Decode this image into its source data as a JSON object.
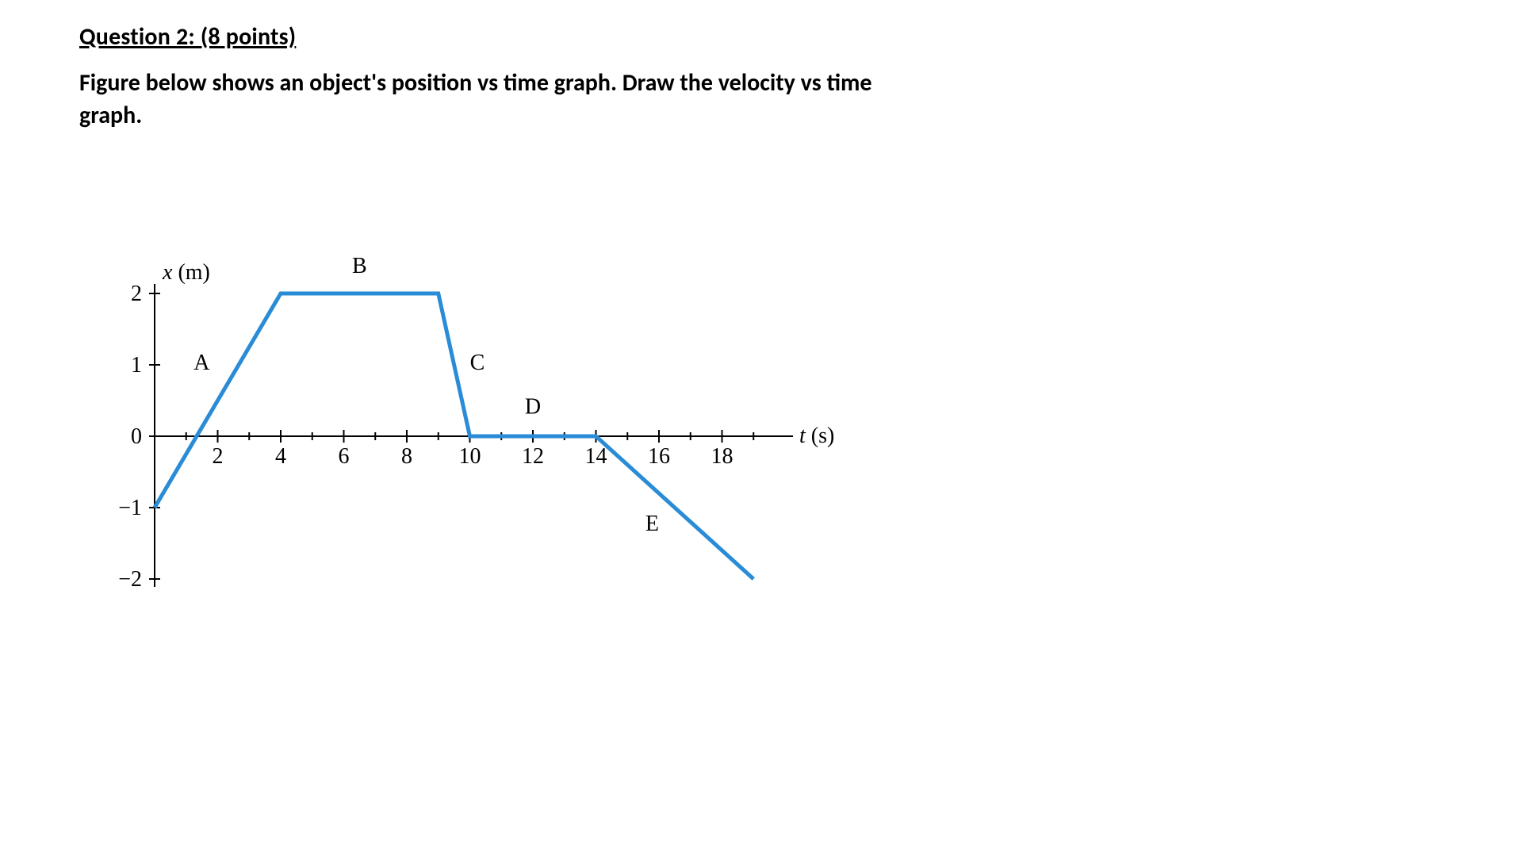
{
  "question": {
    "heading": "Question 2:  (8 points)",
    "body": "Figure below shows an object's position vs time graph.  Draw the velocity vs time graph."
  },
  "chart_data": {
    "type": "line",
    "title": "",
    "xlabel": "t (s)",
    "ylabel": "x (m)",
    "xlim": [
      0,
      20
    ],
    "ylim": [
      -2,
      2
    ],
    "x_ticks": [
      2,
      4,
      6,
      8,
      10,
      12,
      14,
      16,
      18
    ],
    "y_ticks": [
      -2,
      -1,
      0,
      1,
      2
    ],
    "points": [
      {
        "t": 0,
        "x": -1
      },
      {
        "t": 4,
        "x": 2
      },
      {
        "t": 9,
        "x": 2
      },
      {
        "t": 10,
        "x": 0
      },
      {
        "t": 14,
        "x": 0
      },
      {
        "t": 19,
        "x": -2
      }
    ],
    "segment_labels": [
      {
        "name": "A",
        "t": 2,
        "x": 1
      },
      {
        "name": "B",
        "t": 6.5,
        "x": 2.2
      },
      {
        "name": "C",
        "t": 9.7,
        "x": 1
      },
      {
        "name": "D",
        "t": 12,
        "x": 0.25
      },
      {
        "name": "E",
        "t": 16.2,
        "x": -1.1
      }
    ]
  }
}
